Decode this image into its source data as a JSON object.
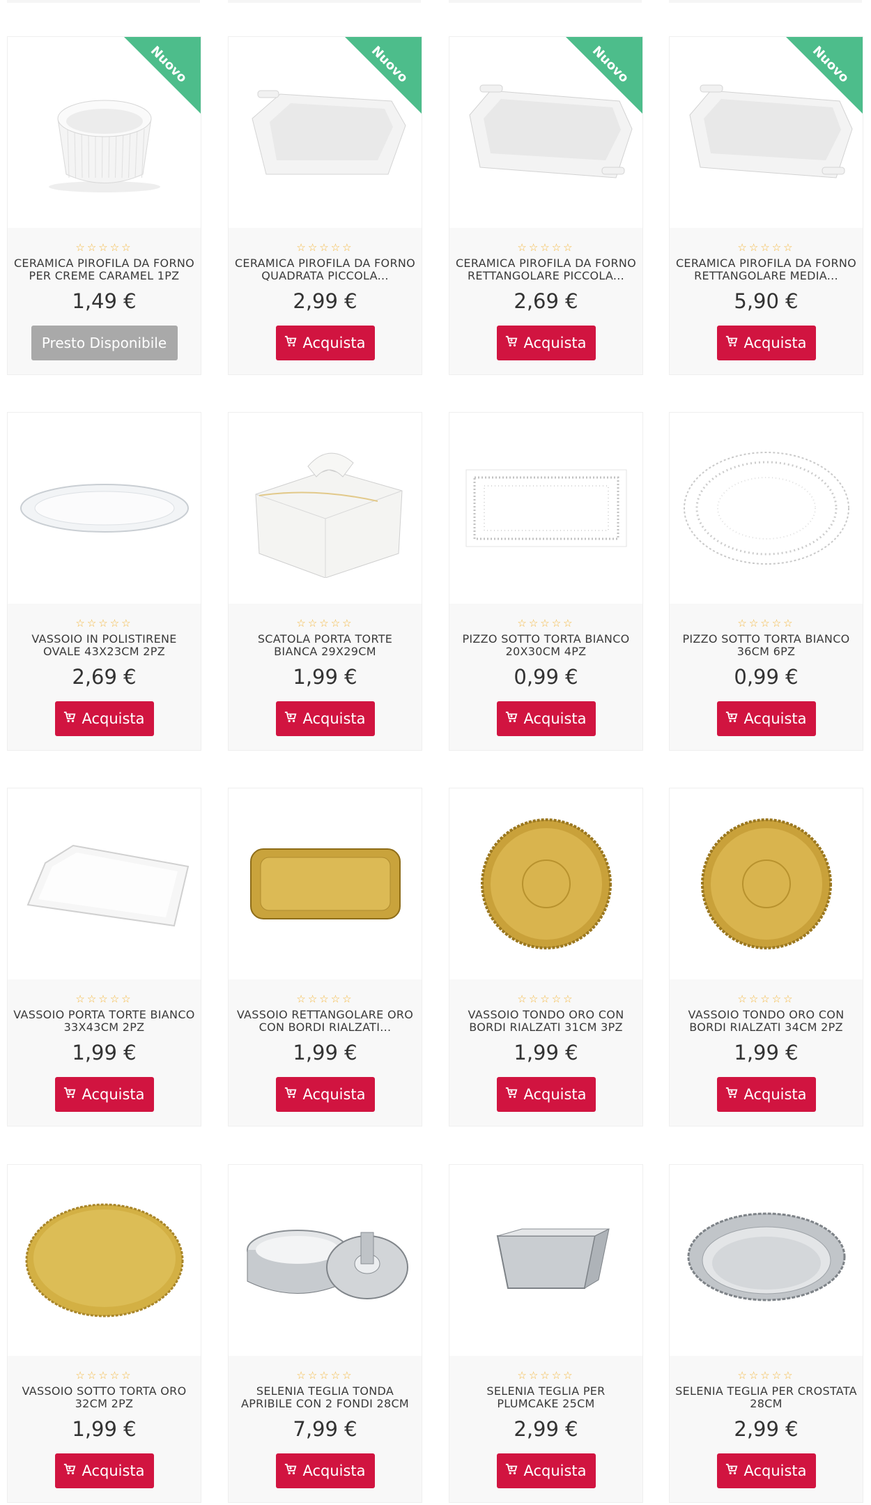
{
  "colors": {
    "accent": "#d11440",
    "unavailable": "#a9a9a9",
    "ribbon": "#4dbd8b",
    "star": "#f4b63c"
  },
  "rating_stars": "☆☆☆☆☆",
  "products": [
    {
      "name": "CERAMICA PIROFILA DA FORNO PER CREME CARAMEL 1PZ",
      "price": "1,49 €",
      "badge": "Nuovo",
      "button": "Presto Disponibile",
      "available": false,
      "image": "white-ramekin"
    },
    {
      "name": "CERAMICA PIROFILA DA FORNO QUADRATA PICCOLA...",
      "price": "2,99 €",
      "badge": "Nuovo",
      "button": "Acquista",
      "available": true,
      "image": "white-square-dish"
    },
    {
      "name": "CERAMICA PIROFILA DA FORNO RETTANGOLARE PICCOLA...",
      "price": "2,69 €",
      "badge": "Nuovo",
      "button": "Acquista",
      "available": true,
      "image": "white-rect-dish"
    },
    {
      "name": "CERAMICA PIROFILA DA FORNO RETTANGOLARE MEDIA...",
      "price": "5,90 €",
      "badge": "Nuovo",
      "button": "Acquista",
      "available": true,
      "image": "white-rect-dish"
    },
    {
      "name": "VASSOIO IN POLISTIRENE OVALE 43X23CM 2PZ",
      "price": "2,69 €",
      "badge": "",
      "button": "Acquista",
      "available": true,
      "image": "oval-tray"
    },
    {
      "name": "SCATOLA PORTA TORTE BIANCA 29X29CM",
      "price": "1,99 €",
      "badge": "",
      "button": "Acquista",
      "available": true,
      "image": "cake-box"
    },
    {
      "name": "PIZZO SOTTO TORTA BIANCO 20X30CM 4PZ",
      "price": "0,99 €",
      "badge": "",
      "button": "Acquista",
      "available": true,
      "image": "rect-doily"
    },
    {
      "name": "PIZZO SOTTO TORTA BIANCO 36CM 6PZ",
      "price": "0,99 €",
      "badge": "",
      "button": "Acquista",
      "available": true,
      "image": "round-doily"
    },
    {
      "name": "VASSOIO PORTA TORTE BIANCO 33X43CM 2PZ",
      "price": "1,99 €",
      "badge": "",
      "button": "Acquista",
      "available": true,
      "image": "white-rect-tray"
    },
    {
      "name": "VASSOIO RETTANGOLARE ORO CON BORDI RIALZATI...",
      "price": "1,99 €",
      "badge": "",
      "button": "Acquista",
      "available": true,
      "image": "gold-rect-tray"
    },
    {
      "name": "VASSOIO TONDO ORO CON BORDI RIALZATI 31CM 3PZ",
      "price": "1,99 €",
      "badge": "",
      "button": "Acquista",
      "available": true,
      "image": "gold-round-tray"
    },
    {
      "name": "VASSOIO TONDO ORO CON BORDI RIALZATI 34CM 2PZ",
      "price": "1,99 €",
      "badge": "",
      "button": "Acquista",
      "available": true,
      "image": "gold-round-tray"
    },
    {
      "name": "VASSOIO SOTTO TORTA ORO 32CM 2PZ",
      "price": "1,99 €",
      "badge": "",
      "button": "Acquista",
      "available": true,
      "image": "gold-board"
    },
    {
      "name": "SELENIA TEGLIA TONDA APRIBILE CON 2 FONDI 28CM",
      "price": "7,99 €",
      "badge": "",
      "button": "Acquista",
      "available": true,
      "image": "springform-pan"
    },
    {
      "name": "SELENIA TEGLIA PER PLUMCAKE 25CM",
      "price": "2,99 €",
      "badge": "",
      "button": "Acquista",
      "available": true,
      "image": "loaf-pan"
    },
    {
      "name": "SELENIA TEGLIA PER CROSTATA 28CM",
      "price": "2,99 €",
      "badge": "",
      "button": "Acquista",
      "available": true,
      "image": "tart-pan"
    }
  ]
}
